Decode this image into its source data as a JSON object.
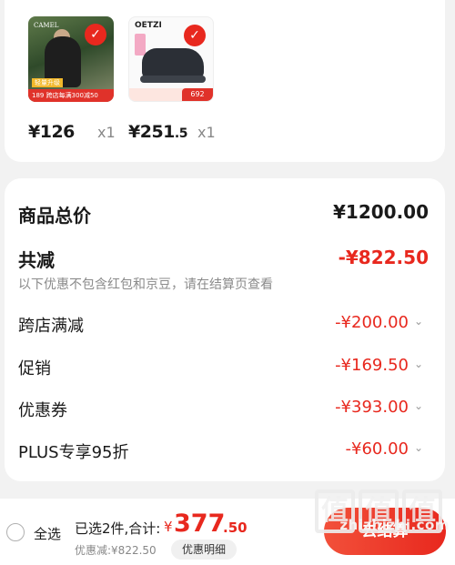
{
  "products": [
    {
      "price_int": "¥126",
      "price_dec": "",
      "qty": "x1",
      "brand": "CAMEL",
      "badge_tag": "轻量升级",
      "badge_line": "跨店每满300减50",
      "badge_price": "189",
      "image_desc": "hiker-backpack"
    },
    {
      "price_int": "¥251",
      "price_dec": ".5",
      "qty": "x1",
      "brand": "OETZI",
      "badge_price": "692",
      "image_desc": "dark-sneaker"
    }
  ],
  "summary": {
    "total_label": "商品总价",
    "total_value": "¥1200.00",
    "reduce_label": "共减",
    "reduce_value": "-¥822.50",
    "note": "以下优惠不包含红包和京豆，请在结算页查看",
    "discounts": [
      {
        "label": "跨店满减",
        "value": "-¥200.00"
      },
      {
        "label": "促销",
        "value": "-¥169.50"
      },
      {
        "label": "优惠券",
        "value": "-¥393.00"
      },
      {
        "label": "PLUS专享95折",
        "value": "-¥60.00"
      }
    ]
  },
  "bottom": {
    "select_all": "全选",
    "selected_text": "已选2件,合计:",
    "currency": "¥",
    "total_int": "377",
    "total_dec": ".50",
    "saved_text": "优惠减:¥822.50",
    "detail_btn": "优惠明细",
    "checkout_btn": "去结算"
  },
  "watermark": {
    "chars": [
      "值",
      "值",
      "值"
    ],
    "url": "zhizhizhi.com"
  },
  "icons": {
    "check": "checkmark-icon",
    "chevron": "chevron-down-icon",
    "radio": "radio-unchecked-icon"
  },
  "colors": {
    "accent": "#e8281e",
    "muted": "#8a8a8a"
  }
}
